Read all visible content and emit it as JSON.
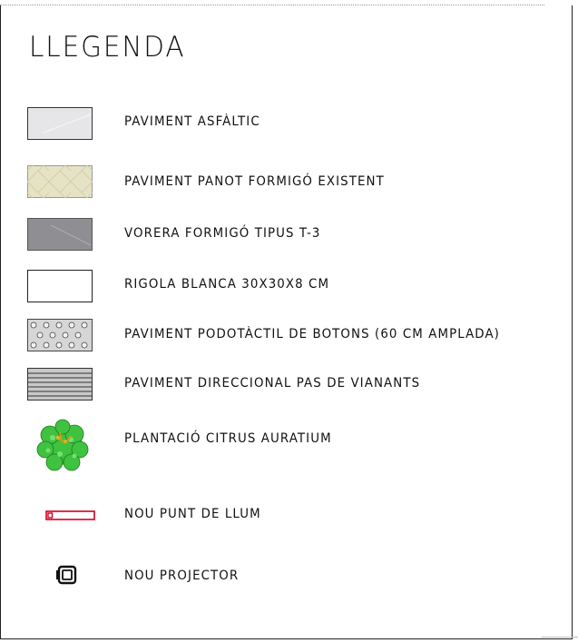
{
  "legend": {
    "title": "LLEGENDA",
    "items": [
      {
        "label": "PAVIMENT ASFÀLTIC",
        "icon": "asphalt-swatch",
        "color": "#e6e6e8"
      },
      {
        "label": "PAVIMENT PANOT FORMIGÓ EXISTENT",
        "icon": "panot-swatch",
        "color": "#e6e2c6"
      },
      {
        "label": "VORERA FORMIGÓ TIPUS T-3",
        "icon": "concrete-swatch",
        "color": "#8f8f93"
      },
      {
        "label": "RIGOLA BLANCA 30X30X8 CM",
        "icon": "white-gutter-swatch",
        "color": "#ffffff"
      },
      {
        "label": "PAVIMENT PODOTÀCTIL DE BOTONS (60 CM AMPLADA)",
        "icon": "tactile-button-swatch",
        "color": "#d6d6d6"
      },
      {
        "label": "PAVIMENT DIRECCIONAL PAS DE VIANANTS",
        "icon": "directional-stripes-swatch",
        "color": "#c8c8c8"
      },
      {
        "label": "PLANTACIÓ CITRUS AURATIUM",
        "icon": "tree-icon",
        "color": "#3fc23f"
      },
      {
        "label": "NOU PUNT DE LLUM",
        "icon": "street-light-icon",
        "color": "#d2001e"
      },
      {
        "label": "NOU PROJECTOR",
        "icon": "projector-icon",
        "color": "#111111"
      }
    ]
  }
}
